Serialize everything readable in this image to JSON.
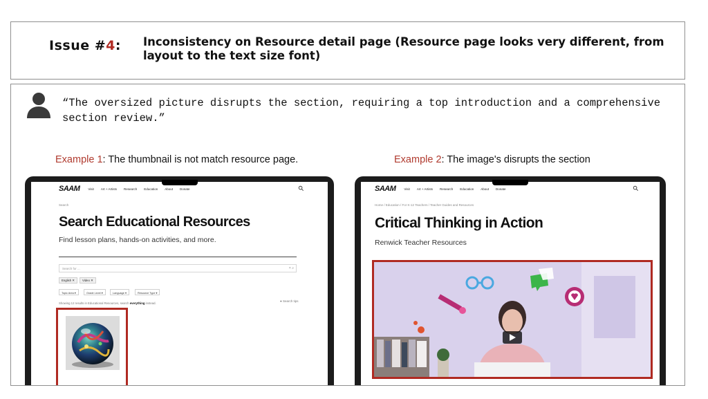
{
  "issue": {
    "label_prefix": "Issue #",
    "number": "4",
    "label_suffix": ":",
    "description": "Inconsistency on Resource detail page (Resource page looks very different, from layout to the text size font)"
  },
  "quote": "“The oversized picture disrupts the section, requiring a top introduction and a comprehensive section review.”",
  "examples": [
    {
      "word": "Example",
      "number": "1",
      "caption": ": The thumbnail is not match resource page.",
      "screen": {
        "logo": "SAAM",
        "nav": [
          "Visit",
          "Art + Artists",
          "Research",
          "Education",
          "About",
          "Donate"
        ],
        "breadcrumb": "Search",
        "title": "Search Educational Resources",
        "subtitle": "Find lesson plans, hands-on activities, and more.",
        "search_placeholder": "Search for ...",
        "chips": [
          "English ✕",
          "Video ✕"
        ],
        "filters": [
          "Topic Area ▾",
          "Grade Level ▾",
          "Language ▾",
          "Resource Type ▾"
        ],
        "results_text": "Showing 12 results in Educational Resources, search ",
        "results_bold": "everything",
        "results_suffix": " instead.",
        "search_tips": "Search tips"
      }
    },
    {
      "word": "Example",
      "number": "2",
      "caption": ": The image's disrupts the section",
      "screen": {
        "logo": "SAAM",
        "nav": [
          "Visit",
          "Art + Artists",
          "Research",
          "Education",
          "About",
          "Donate"
        ],
        "breadcrumb": "Home  /  Education  /  For K-12 Teachers  /  Teacher Guides and Resources",
        "title": "Critical Thinking in Action",
        "subtitle": "Renwick Teacher Resources"
      }
    }
  ],
  "colors": {
    "accent_red": "#b02a22",
    "laptop_frame": "#1c1c1c",
    "video_background": "#d9d1ec"
  }
}
